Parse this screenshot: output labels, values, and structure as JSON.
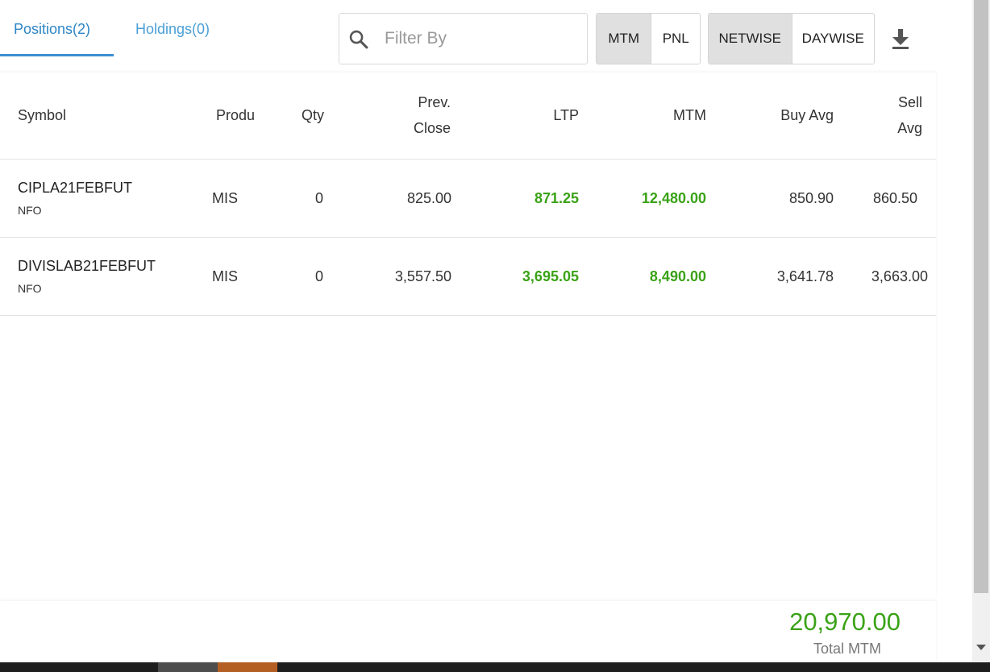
{
  "tabs": [
    {
      "label": "Positions(2)"
    },
    {
      "label": "Holdings(0)"
    }
  ],
  "search": {
    "placeholder": "Filter By"
  },
  "view_toggle": {
    "mtm": "MTM",
    "pnl": "PNL",
    "selected": "MTM"
  },
  "period_toggle": {
    "netwise": "NETWISE",
    "daywise": "DAYWISE",
    "selected": "NETWISE"
  },
  "columns": {
    "symbol": "Symbol",
    "product": "Produ",
    "qty": "Qty",
    "prev_close_1": "Prev.",
    "prev_close_2": "Close",
    "ltp": "LTP",
    "mtm": "MTM",
    "buy_avg": "Buy Avg",
    "sell_avg_1": "Sell",
    "sell_avg_2": "Avg"
  },
  "rows": [
    {
      "symbol": "CIPLA21FEBFUT",
      "exchange": "NFO",
      "product": "MIS",
      "qty": "0",
      "prev_close": "825.00",
      "ltp": "871.25",
      "mtm": "12,480.00",
      "buy_avg": "850.90",
      "sell_avg": "860.50"
    },
    {
      "symbol": "DIVISLAB21FEBFUT",
      "exchange": "NFO",
      "product": "MIS",
      "qty": "0",
      "prev_close": "3,557.50",
      "ltp": "3,695.05",
      "mtm": "8,490.00",
      "buy_avg": "3,641.78",
      "sell_avg": "3,663.00"
    }
  ],
  "footer": {
    "total_value": "20,970.00",
    "total_label": "Total MTM"
  },
  "colors": {
    "accent": "#3d8fd1",
    "positive": "#3aa217"
  }
}
